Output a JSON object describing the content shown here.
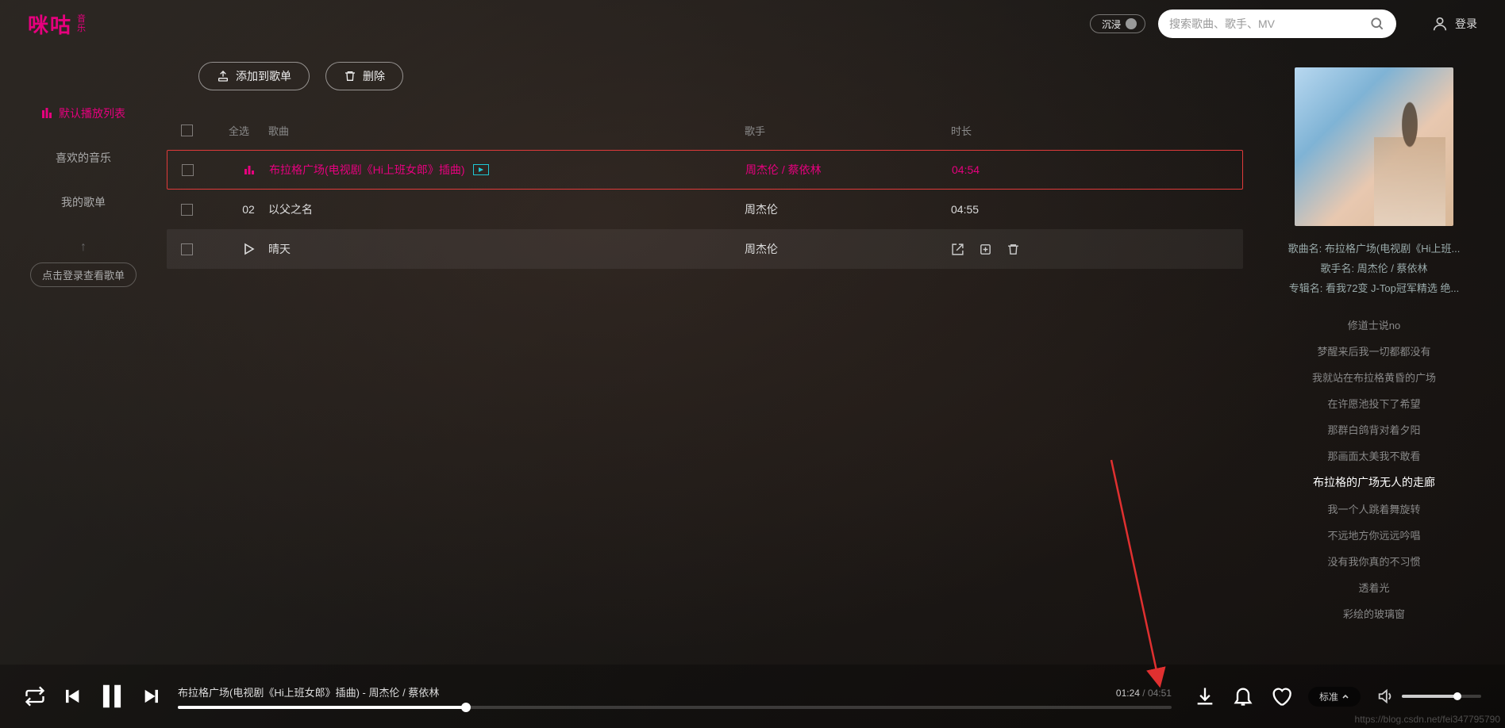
{
  "header": {
    "logo_main": "咪咕",
    "logo_sub1": "音",
    "logo_sub2": "乐",
    "immersive": "沉浸",
    "search_placeholder": "搜索歌曲、歌手、MV",
    "login": "登录"
  },
  "sidebar": {
    "items": [
      {
        "label": "默认播放列表",
        "active": true
      },
      {
        "label": "喜欢的音乐",
        "active": false
      },
      {
        "label": "我的歌单",
        "active": false
      }
    ],
    "login_hint": "点击登录查看歌单"
  },
  "toolbar": {
    "add_playlist": "添加到歌单",
    "delete": "删除"
  },
  "list": {
    "headers": {
      "select_all": "全选",
      "song": "歌曲",
      "artist": "歌手",
      "duration": "时长"
    },
    "rows": [
      {
        "num": "",
        "title": "布拉格广场(电视剧《Hi上班女郎》插曲)",
        "artist": "周杰伦 / 蔡依林",
        "duration": "04:54",
        "active": true,
        "has_mv": true
      },
      {
        "num": "02",
        "title": "以父之名",
        "artist": "周杰伦",
        "duration": "04:55",
        "active": false,
        "has_mv": false
      },
      {
        "num": "",
        "title": "晴天",
        "artist": "周杰伦",
        "duration": "",
        "active": false,
        "has_mv": false,
        "hover": true
      }
    ]
  },
  "rightpanel": {
    "song_label": "歌曲名:",
    "song_value": "布拉格广场(电视剧《Hi上班...",
    "artist_label": "歌手名:",
    "artist_value": "周杰伦 / 蔡依林",
    "album_label": "专辑名:",
    "album_value": "看我72变 J-Top冠军精选 绝...",
    "lyrics": [
      "修道士说no",
      "梦醒来后我一切都都没有",
      "我就站在布拉格黄昏的广场",
      "在许愿池投下了希望",
      "那群白鸽背对着夕阳",
      "那画面太美我不敢看",
      "布拉格的广场无人的走廊",
      "我一个人跳着舞旋转",
      "不远地方你远远吟唱",
      "没有我你真的不习惯",
      "透着光",
      "彩绘的玻璃窗"
    ],
    "current_lyric_index": 6
  },
  "player": {
    "now_playing": "布拉格广场(电视剧《Hi上班女郎》插曲) - 周杰伦 / 蔡依林",
    "current_time": "01:24",
    "total_time": "04:51",
    "quality": "标准"
  },
  "watermark": "https://blog.csdn.net/fei347795790"
}
